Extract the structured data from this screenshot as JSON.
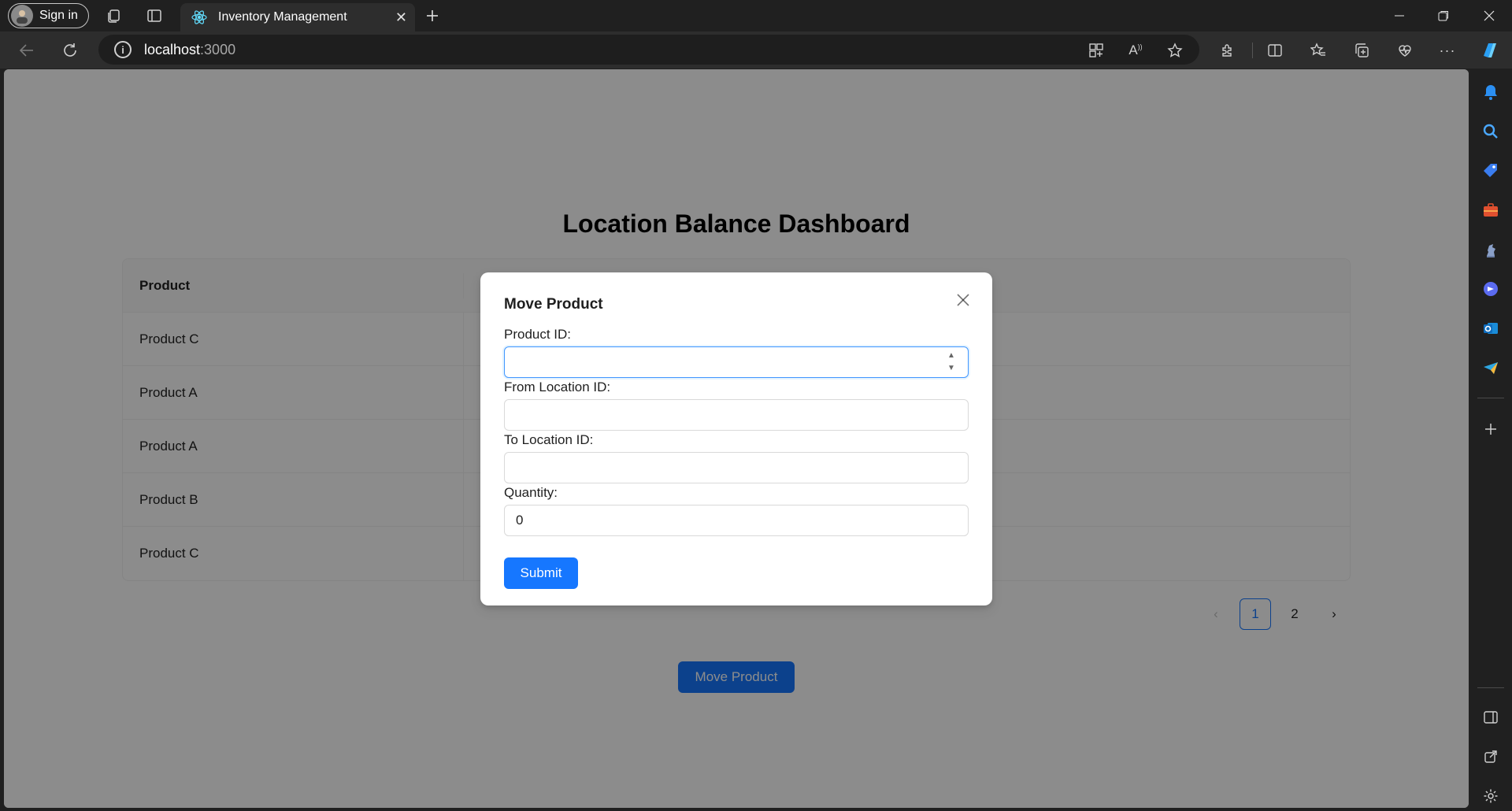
{
  "browser": {
    "profile_label": "Sign in",
    "tab_title": "Inventory Management",
    "url_host": "localhost",
    "url_port": ":3000"
  },
  "page": {
    "title": "Location Balance Dashboard",
    "table": {
      "header": "Product",
      "rows": [
        "Product C",
        "Product A",
        "Product A",
        "Product B",
        "Product C"
      ]
    },
    "pagination": {
      "prev_icon": "‹",
      "pages": [
        "1",
        "2"
      ],
      "active_page": "1",
      "next_icon": "›"
    },
    "move_button_label": "Move Product"
  },
  "modal": {
    "title": "Move Product",
    "close_icon": "✕",
    "fields": [
      {
        "label": "Product ID:",
        "value": ""
      },
      {
        "label": "From Location ID:",
        "value": ""
      },
      {
        "label": "To Location ID:",
        "value": ""
      },
      {
        "label": "Quantity:",
        "value": "0"
      }
    ],
    "submit_label": "Submit"
  },
  "colors": {
    "primary": "#1677ff",
    "overlay": "rgba(0,0,0,0.45)"
  }
}
